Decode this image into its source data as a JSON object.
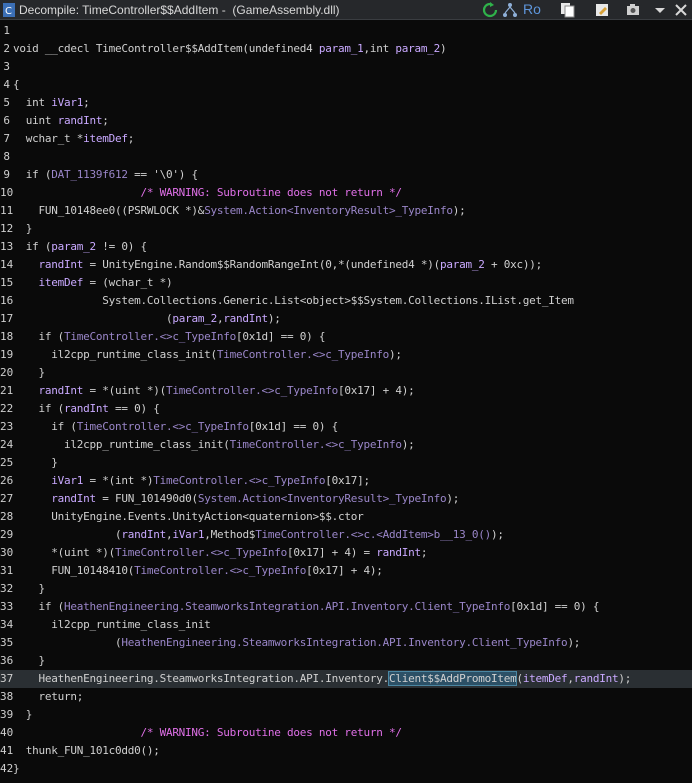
{
  "window": {
    "title": "Decompile: TimeController$$AddItem -  (GameAssembly.dll)",
    "toolbar_ro": "Ro"
  },
  "icons": [
    "decompile-icon",
    "refresh-icon",
    "graph-icon",
    "copy-icon",
    "edit-icon",
    "snapshot-icon",
    "chevron-down-icon",
    "close-icon"
  ],
  "lines": [
    {
      "n": "1",
      "segs": []
    },
    {
      "n": "2",
      "segs": [
        [
          "t",
          "void __cdecl TimeController$$AddItem(undefined4 "
        ],
        [
          "v",
          "param_1"
        ],
        [
          "t",
          ",int "
        ],
        [
          "v",
          "param_2"
        ],
        [
          "t",
          ")"
        ]
      ]
    },
    {
      "n": "3",
      "segs": []
    },
    {
      "n": "4",
      "segs": [
        [
          "t",
          "{"
        ]
      ]
    },
    {
      "n": "5",
      "segs": [
        [
          "t",
          "  int "
        ],
        [
          "v",
          "iVar1"
        ],
        [
          "t",
          ";"
        ]
      ]
    },
    {
      "n": "6",
      "segs": [
        [
          "t",
          "  uint "
        ],
        [
          "v",
          "randInt"
        ],
        [
          "t",
          ";"
        ]
      ]
    },
    {
      "n": "7",
      "segs": [
        [
          "t",
          "  wchar_t *"
        ],
        [
          "v",
          "itemDef"
        ],
        [
          "t",
          ";"
        ]
      ]
    },
    {
      "n": "8",
      "segs": []
    },
    {
      "n": "9",
      "segs": [
        [
          "t",
          "  if ("
        ],
        [
          "g",
          "DAT_1139f612"
        ],
        [
          "t",
          " == '\\0') {"
        ]
      ]
    },
    {
      "n": "10",
      "segs": [
        [
          "c",
          "                    /* WARNING: Subroutine does not return */"
        ]
      ]
    },
    {
      "n": "11",
      "segs": [
        [
          "t",
          "    FUN_10148ee0((PSRWLOCK *)&"
        ],
        [
          "g",
          "System.Action<InventoryResult>_TypeInfo"
        ],
        [
          "t",
          ");"
        ]
      ]
    },
    {
      "n": "12",
      "segs": [
        [
          "t",
          "  }"
        ]
      ]
    },
    {
      "n": "13",
      "segs": [
        [
          "t",
          "  if ("
        ],
        [
          "v",
          "param_2"
        ],
        [
          "t",
          " != 0) {"
        ]
      ]
    },
    {
      "n": "14",
      "segs": [
        [
          "t",
          "    "
        ],
        [
          "v",
          "randInt"
        ],
        [
          "t",
          " = UnityEngine.Random$$RandomRangeInt(0,*(undefined4 *)("
        ],
        [
          "v",
          "param_2"
        ],
        [
          "t",
          " + 0xc));"
        ]
      ]
    },
    {
      "n": "15",
      "segs": [
        [
          "t",
          "    "
        ],
        [
          "v",
          "itemDef"
        ],
        [
          "t",
          " = (wchar_t *)"
        ]
      ]
    },
    {
      "n": "16",
      "segs": [
        [
          "t",
          "              System.Collections.Generic.List<object>$$System.Collections.IList.get_Item"
        ]
      ]
    },
    {
      "n": "17",
      "segs": [
        [
          "t",
          "                        ("
        ],
        [
          "v",
          "param_2"
        ],
        [
          "t",
          ","
        ],
        [
          "v",
          "randInt"
        ],
        [
          "t",
          ");"
        ]
      ]
    },
    {
      "n": "18",
      "segs": [
        [
          "t",
          "    if ("
        ],
        [
          "g",
          "TimeController.<>c_TypeInfo"
        ],
        [
          "t",
          "[0x1d] == 0) {"
        ]
      ]
    },
    {
      "n": "19",
      "segs": [
        [
          "t",
          "      il2cpp_runtime_class_init("
        ],
        [
          "g",
          "TimeController.<>c_TypeInfo"
        ],
        [
          "t",
          ");"
        ]
      ]
    },
    {
      "n": "20",
      "segs": [
        [
          "t",
          "    }"
        ]
      ]
    },
    {
      "n": "21",
      "segs": [
        [
          "t",
          "    "
        ],
        [
          "v",
          "randInt"
        ],
        [
          "t",
          " = *(uint *)("
        ],
        [
          "g",
          "TimeController.<>c_TypeInfo"
        ],
        [
          "t",
          "[0x17] + 4);"
        ]
      ]
    },
    {
      "n": "22",
      "segs": [
        [
          "t",
          "    if ("
        ],
        [
          "v",
          "randInt"
        ],
        [
          "t",
          " == 0) {"
        ]
      ]
    },
    {
      "n": "23",
      "segs": [
        [
          "t",
          "      if ("
        ],
        [
          "g",
          "TimeController.<>c_TypeInfo"
        ],
        [
          "t",
          "[0x1d] == 0) {"
        ]
      ]
    },
    {
      "n": "24",
      "segs": [
        [
          "t",
          "        il2cpp_runtime_class_init("
        ],
        [
          "g",
          "TimeController.<>c_TypeInfo"
        ],
        [
          "t",
          ");"
        ]
      ]
    },
    {
      "n": "25",
      "segs": [
        [
          "t",
          "      }"
        ]
      ]
    },
    {
      "n": "26",
      "segs": [
        [
          "t",
          "      "
        ],
        [
          "v",
          "iVar1"
        ],
        [
          "t",
          " = *(int *)"
        ],
        [
          "g",
          "TimeController.<>c_TypeInfo"
        ],
        [
          "t",
          "[0x17];"
        ]
      ]
    },
    {
      "n": "27",
      "segs": [
        [
          "t",
          "      "
        ],
        [
          "v",
          "randInt"
        ],
        [
          "t",
          " = FUN_101490d0("
        ],
        [
          "g",
          "System.Action<InventoryResult>_TypeInfo"
        ],
        [
          "t",
          ");"
        ]
      ]
    },
    {
      "n": "28",
      "segs": [
        [
          "t",
          "      UnityEngine.Events.UnityAction<quaternion>$$.ctor"
        ]
      ]
    },
    {
      "n": "29",
      "segs": [
        [
          "t",
          "                ("
        ],
        [
          "v",
          "randInt"
        ],
        [
          "t",
          ","
        ],
        [
          "v",
          "iVar1"
        ],
        [
          "t",
          ",Method$"
        ],
        [
          "g",
          "TimeController.<>c.<AddItem>b__13_0()"
        ],
        [
          "t",
          ");"
        ]
      ]
    },
    {
      "n": "30",
      "segs": [
        [
          "t",
          "      *(uint *)("
        ],
        [
          "g",
          "TimeController.<>c_TypeInfo"
        ],
        [
          "t",
          "[0x17] + 4) = "
        ],
        [
          "v",
          "randInt"
        ],
        [
          "t",
          ";"
        ]
      ]
    },
    {
      "n": "31",
      "segs": [
        [
          "t",
          "      FUN_10148410("
        ],
        [
          "g",
          "TimeController.<>c_TypeInfo"
        ],
        [
          "t",
          "[0x17] + 4);"
        ]
      ]
    },
    {
      "n": "32",
      "segs": [
        [
          "t",
          "    }"
        ]
      ]
    },
    {
      "n": "33",
      "segs": [
        [
          "t",
          "    if ("
        ],
        [
          "g",
          "HeathenEngineering.SteamworksIntegration.API.Inventory.Client_TypeInfo"
        ],
        [
          "t",
          "[0x1d] == 0) {"
        ]
      ]
    },
    {
      "n": "34",
      "segs": [
        [
          "t",
          "      il2cpp_runtime_class_init"
        ]
      ]
    },
    {
      "n": "35",
      "segs": [
        [
          "t",
          "                ("
        ],
        [
          "g",
          "HeathenEngineering.SteamworksIntegration.API.Inventory.Client_TypeInfo"
        ],
        [
          "t",
          ");"
        ]
      ]
    },
    {
      "n": "36",
      "segs": [
        [
          "t",
          "    }"
        ]
      ]
    },
    {
      "n": "37",
      "segs": [
        [
          "t",
          "    HeathenEngineering.SteamworksIntegration.API.Inventory."
        ],
        [
          "h",
          "Client$$AddPromoItem"
        ],
        [
          "t",
          "("
        ],
        [
          "v",
          "itemDef"
        ],
        [
          "t",
          ","
        ],
        [
          "v",
          "randInt"
        ],
        [
          "t",
          ");"
        ]
      ],
      "hl": true
    },
    {
      "n": "38",
      "segs": [
        [
          "t",
          "    return;"
        ]
      ]
    },
    {
      "n": "39",
      "segs": [
        [
          "t",
          "  }"
        ]
      ]
    },
    {
      "n": "40",
      "segs": [
        [
          "c",
          "                    /* WARNING: Subroutine does not return */"
        ]
      ]
    },
    {
      "n": "41",
      "segs": [
        [
          "t",
          "  thunk_FUN_101c0dd0();"
        ]
      ]
    },
    {
      "n": "42",
      "segs": [
        [
          "t",
          "}"
        ]
      ]
    }
  ]
}
